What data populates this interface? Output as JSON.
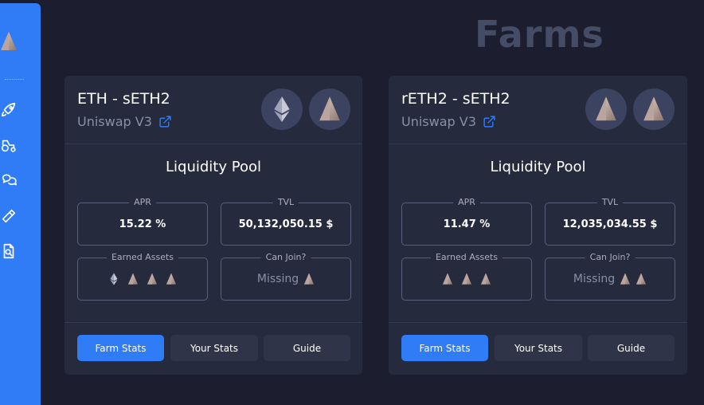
{
  "page_title": "Farms",
  "sidebar": {
    "items": [
      {
        "icon": "rocket-icon"
      },
      {
        "icon": "tractor-icon"
      },
      {
        "icon": "chat-icon"
      },
      {
        "icon": "hammer-icon"
      },
      {
        "icon": "document-search-icon"
      }
    ]
  },
  "colors": {
    "accent": "#2f7cf6",
    "card_bg": "#262a3d",
    "page_bg": "#1c1d2e"
  },
  "farms": [
    {
      "pair": "ETH - sETH2",
      "dex": "Uniswap V3",
      "pool_title": "Liquidity Pool",
      "apr_label": "APR",
      "apr": "15.22 %",
      "tvl_label": "TVL",
      "tvl": "50,132,050.15 $",
      "earned_label": "Earned Assets",
      "join_label": "Can Join?",
      "join_status": "Missing",
      "buttons": {
        "farm_stats": "Farm Stats",
        "your_stats": "Your Stats",
        "guide": "Guide"
      }
    },
    {
      "pair": "rETH2 - sETH2",
      "dex": "Uniswap V3",
      "pool_title": "Liquidity Pool",
      "apr_label": "APR",
      "apr": "11.47 %",
      "tvl_label": "TVL",
      "tvl": "12,035,034.55 $",
      "earned_label": "Earned Assets",
      "join_label": "Can Join?",
      "join_status": "Missing",
      "buttons": {
        "farm_stats": "Farm Stats",
        "your_stats": "Your Stats",
        "guide": "Guide"
      }
    }
  ]
}
